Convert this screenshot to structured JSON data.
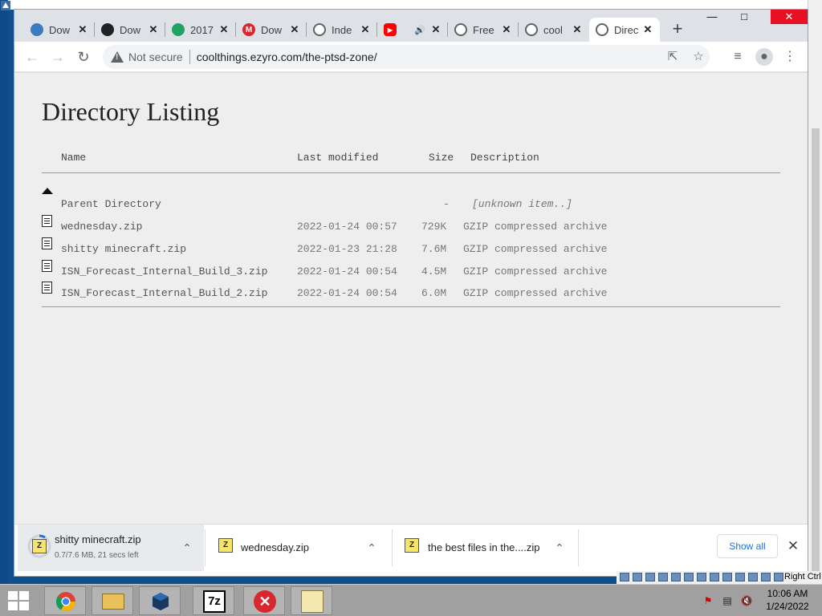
{
  "browser": {
    "tabs": [
      {
        "title": "Dow",
        "icon": "download-page-icon",
        "color": "#3b7bbf"
      },
      {
        "title": "Dow",
        "icon": "download-arrow-icon",
        "color": "#202124"
      },
      {
        "title": "2017",
        "icon": "google-drive-icon",
        "color": "#1fa463"
      },
      {
        "title": "Dow",
        "icon": "mega-icon",
        "color": "#d9272e"
      },
      {
        "title": "Inde",
        "icon": "globe-icon",
        "color": "#5f6368"
      },
      {
        "title": "",
        "icon": "youtube-icon",
        "color": "#ff0000",
        "audio": true
      },
      {
        "title": "Free",
        "icon": "globe-icon",
        "color": "#5f6368"
      },
      {
        "title": "cool",
        "icon": "globe-icon",
        "color": "#5f6368"
      },
      {
        "title": "Direc",
        "icon": "globe-icon",
        "color": "#5f6368",
        "active": true
      }
    ],
    "new_tab": "+",
    "security_label": "Not secure",
    "url": "coolthings.ezyro.com/the-ptsd-zone/"
  },
  "listing": {
    "heading": "Directory Listing",
    "columns": {
      "name": "Name",
      "modified": "Last modified",
      "size": "Size",
      "description": "Description"
    },
    "parent": {
      "name": "Parent Directory",
      "modified": "",
      "size": "-",
      "description": "[unknown item..]"
    },
    "files": [
      {
        "name": "wednesday.zip",
        "modified": "2022-01-24 00:57",
        "size": "729K",
        "description": "GZIP compressed archive"
      },
      {
        "name": "shitty minecraft.zip",
        "modified": "2022-01-23 21:28",
        "size": "7.6M",
        "description": "GZIP compressed archive"
      },
      {
        "name": "ISN_Forecast_Internal_Build_3.zip",
        "modified": "2022-01-24 00:54",
        "size": "4.5M",
        "description": "GZIP compressed archive"
      },
      {
        "name": "ISN_Forecast_Internal_Build_2.zip",
        "modified": "2022-01-24 00:54",
        "size": "6.0M",
        "description": "GZIP compressed archive"
      }
    ]
  },
  "downloads": {
    "items": [
      {
        "name": "shitty minecraft.zip",
        "status": "0.7/7.6 MB, 21 secs left",
        "progress": 0.09
      },
      {
        "name": "wednesday.zip",
        "status": ""
      },
      {
        "name": "the best files in the....zip",
        "status": ""
      }
    ],
    "show_all": "Show all"
  },
  "vbox": {
    "host_key": "Right Ctrl"
  },
  "taskbar": {
    "apps": [
      "chrome-icon",
      "file-explorer-icon",
      "virtualbox-icon",
      "7zip-icon",
      "error-app-icon",
      "notepad-icon"
    ],
    "time": "10:06 AM",
    "date": "1/24/2022"
  }
}
